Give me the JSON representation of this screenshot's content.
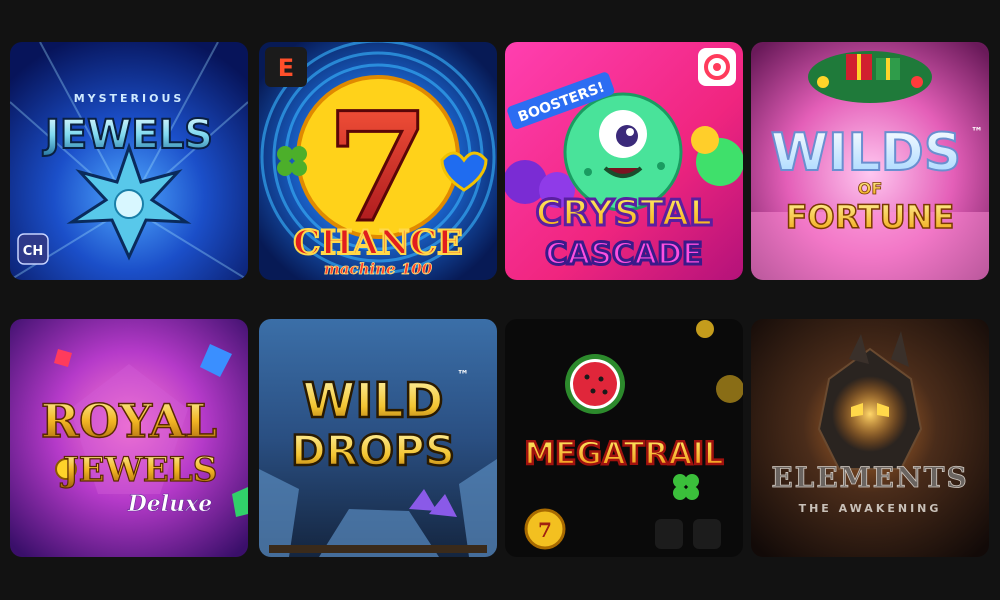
{
  "games": [
    {
      "title_top": "MYSTERIOUS",
      "title_main": "JEWELS",
      "provider_badge": "CH"
    },
    {
      "provider_badge": "E",
      "big_number": "7",
      "title_main": "CHANCE",
      "title_sub": "machine 100"
    },
    {
      "banner": "BOOSTERS!",
      "title_line1": "CRYSTAL",
      "title_line2": "CASCADE"
    },
    {
      "title_main": "WILDS",
      "tm": "™",
      "title_of": "OF",
      "title_line2": "FORTUNE"
    },
    {
      "title_line1": "ROYAL",
      "title_line2": "JEWELS",
      "title_script": "Deluxe"
    },
    {
      "title_line1": "WILD",
      "tm": "™",
      "title_line2": "DROPS"
    },
    {
      "title_main": "MEGATRAIL",
      "coin_number": "7"
    },
    {
      "title_main": "ELEMENTS",
      "title_sub": "THE AWAKENING"
    }
  ],
  "colors": {
    "page_bg": "#121212"
  }
}
